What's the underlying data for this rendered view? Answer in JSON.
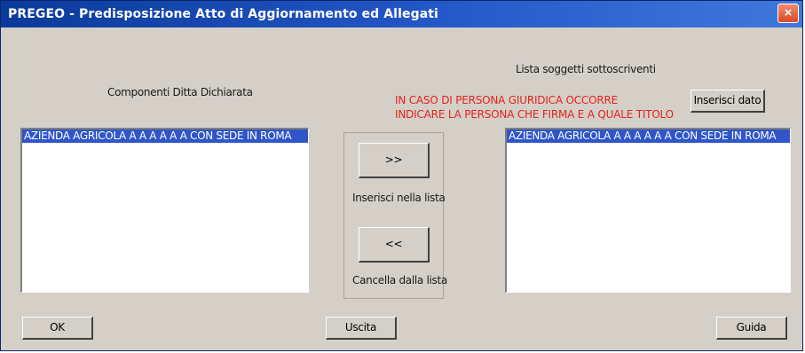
{
  "window": {
    "title": "PREGEO - Predisposizione Atto di Aggiornamento ed Allegati",
    "close_glyph": "×"
  },
  "left": {
    "label": "Componenti Ditta Dichiarata",
    "items": [
      "AZIENDA AGRICOLA A A A A A A  CON SEDE IN ROMA"
    ]
  },
  "right": {
    "label": "Lista soggetti sottoscriventi",
    "warning_line1": "IN CASO DI PERSONA GIURIDICA OCCORRE",
    "warning_line2": "INDICARE LA PERSONA CHE FIRMA E A QUALE TITOLO",
    "insert_data_label": "Inserisci dato",
    "items": [
      "AZIENDA AGRICOLA A A A A A A  CON SEDE IN ROMA"
    ]
  },
  "middle": {
    "add_label": ">>",
    "add_caption": "Inserisci nella lista",
    "remove_label": "<<",
    "remove_caption": "Cancella dalla lista"
  },
  "footer": {
    "ok_label": "OK",
    "exit_label": "Uscita",
    "help_label": "Guida"
  },
  "colors": {
    "title_bar": "#2458c8",
    "selection": "#2f55c8",
    "warning_text": "#e4221e",
    "face": "#d4d0c8"
  }
}
